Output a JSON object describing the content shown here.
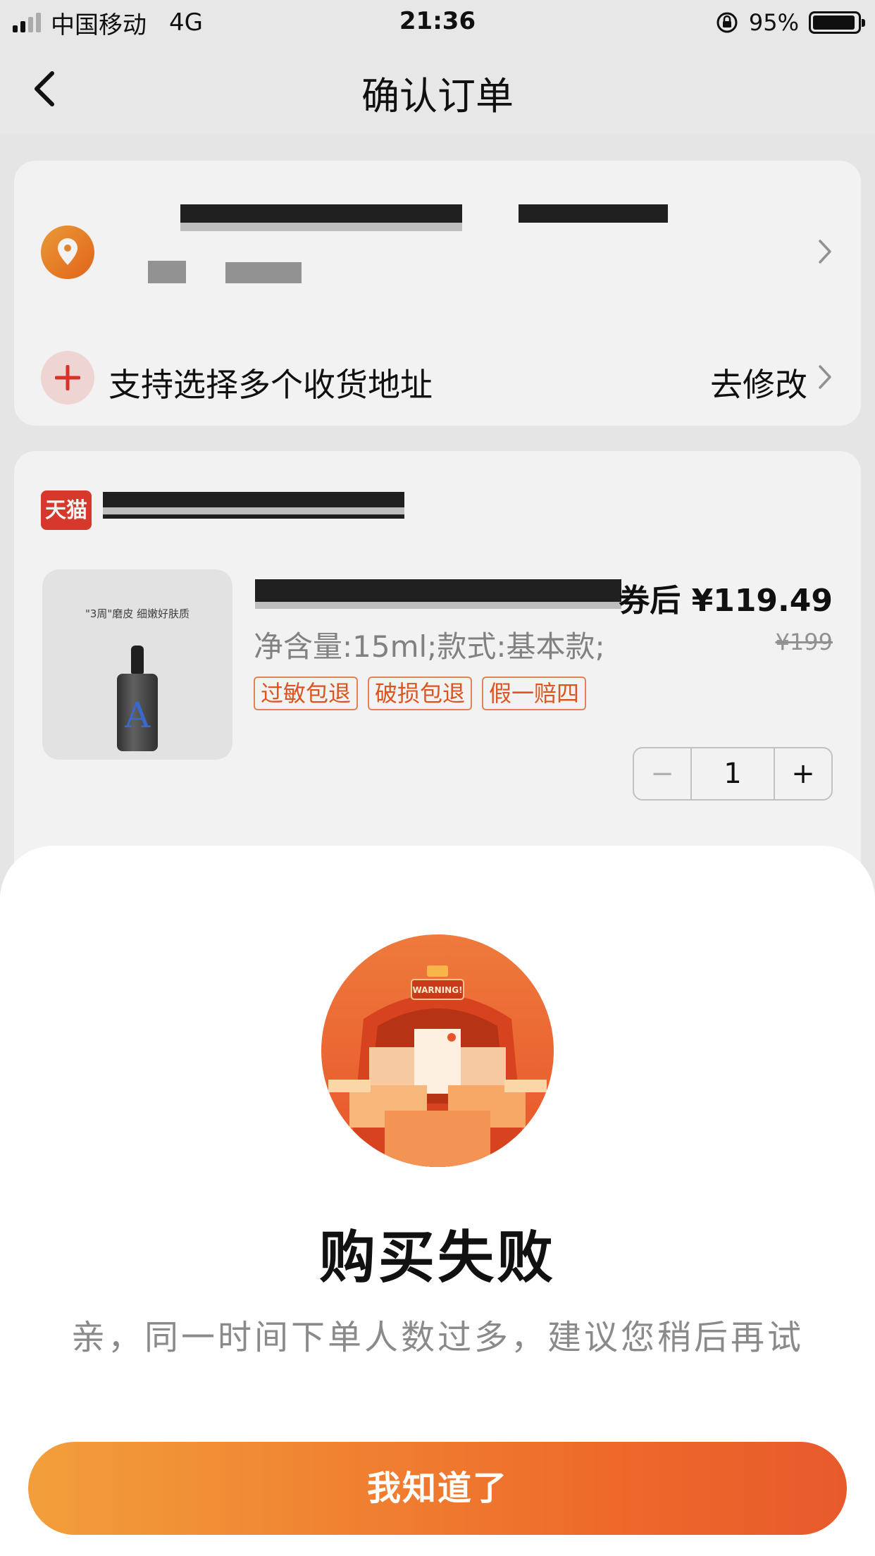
{
  "status_bar": {
    "carrier": "中国移动",
    "network": "4G",
    "time": "21:36",
    "battery": "95%",
    "battery_level": 0.95
  },
  "nav": {
    "title": "确认订单",
    "back_icon": "chevron-left-icon"
  },
  "address_card": {
    "pin_icon": "location-pin-icon",
    "multi_address_label": "支持选择多个收货地址",
    "modify_label": "去修改",
    "chevron_icon": "chevron-right-icon"
  },
  "product_card": {
    "store_logo_text": "天猫",
    "image_caption": "\"3周\"磨皮 细嫩好肤质",
    "image_letter": "A",
    "spec": "净含量:15ml;款式:基本款;",
    "tags": [
      "过敏包退",
      "破损包退",
      "假一赔四"
    ],
    "coupon_price": "券后 ¥119.49",
    "original_price": "¥199",
    "quantity": "1",
    "minus_label": "−",
    "plus_label": "+"
  },
  "dialog": {
    "illustration_icon": "warning-delivery-truck-illustration",
    "illustration_text": "WARNING!",
    "title": "购买失败",
    "message": "亲，同一时间下单人数过多，建议您稍后再试",
    "confirm_label": "我知道了"
  },
  "colors": {
    "accent_start": "#f29f3b",
    "accent_end": "#e85a2c",
    "tag_color": "#e85a22",
    "tmall_red": "#e33c2f"
  }
}
